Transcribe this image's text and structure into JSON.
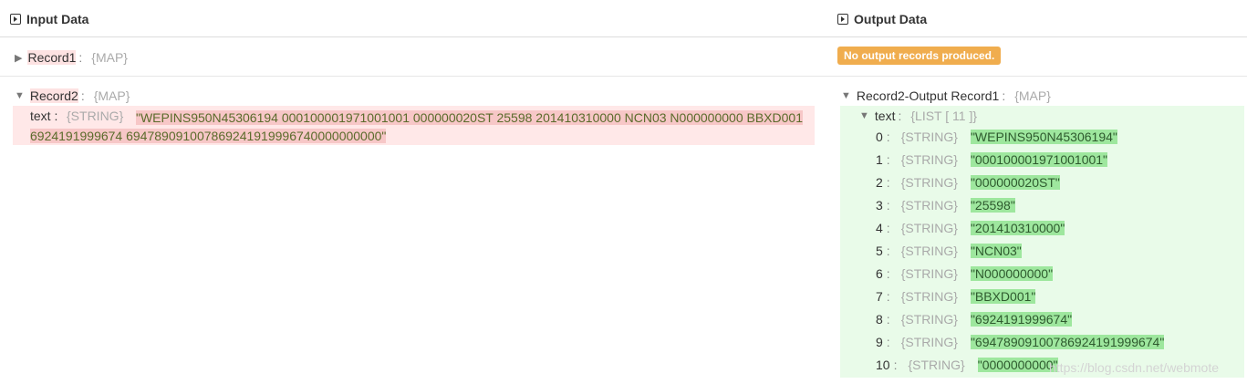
{
  "header": {
    "input_title": "Input Data",
    "output_title": "Output Data"
  },
  "input": {
    "record1": {
      "name": "Record1",
      "colon": ":",
      "type": "{MAP}",
      "collapsed_glyph": "▶"
    },
    "record2": {
      "name": "Record2",
      "colon": ":",
      "type": "{MAP}",
      "expanded_glyph": "▼",
      "field": {
        "key": "text",
        "colon": ":",
        "type": "{STRING}",
        "value": "\"WEPINS950N45306194 000100001971001001 000000020ST 25598 201410310000 NCN03 N000000000 BBXD001 6924191999674 694789091007869241919996740000000000\""
      }
    }
  },
  "output": {
    "no_output_badge": "No output records produced.",
    "record": {
      "name": "Record2-Output Record1",
      "colon": ":",
      "type": "{MAP}",
      "expanded_glyph": "▼",
      "field": {
        "key": "text",
        "colon": ":",
        "type": "{LIST [ 11 ]}",
        "expanded_glyph": "▼",
        "items": [
          {
            "index": "0",
            "colon": ":",
            "type": "{STRING}",
            "value": "\"WEPINS950N45306194\""
          },
          {
            "index": "1",
            "colon": ":",
            "type": "{STRING}",
            "value": "\"000100001971001001\""
          },
          {
            "index": "2",
            "colon": ":",
            "type": "{STRING}",
            "value": "\"000000020ST\""
          },
          {
            "index": "3",
            "colon": ":",
            "type": "{STRING}",
            "value": "\"25598\""
          },
          {
            "index": "4",
            "colon": ":",
            "type": "{STRING}",
            "value": "\"201410310000\""
          },
          {
            "index": "5",
            "colon": ":",
            "type": "{STRING}",
            "value": "\"NCN03\""
          },
          {
            "index": "6",
            "colon": ":",
            "type": "{STRING}",
            "value": "\"N000000000\""
          },
          {
            "index": "7",
            "colon": ":",
            "type": "{STRING}",
            "value": "\"BBXD001\""
          },
          {
            "index": "8",
            "colon": ":",
            "type": "{STRING}",
            "value": "\"6924191999674\""
          },
          {
            "index": "9",
            "colon": ":",
            "type": "{STRING}",
            "value": "\"69478909100786924191999674\""
          },
          {
            "index": "10",
            "colon": ":",
            "type": "{STRING}",
            "value": "\"0000000000\""
          }
        ]
      }
    }
  },
  "watermark": "https://blog.csdn.net/webmote",
  "colors": {
    "error_bg": "#ffe8e8",
    "error_value_bg": "#f7c7c7",
    "success_bg": "#e9fbe9",
    "success_value_bg": "#9ee79e",
    "warning_badge": "#f0ad4e"
  }
}
